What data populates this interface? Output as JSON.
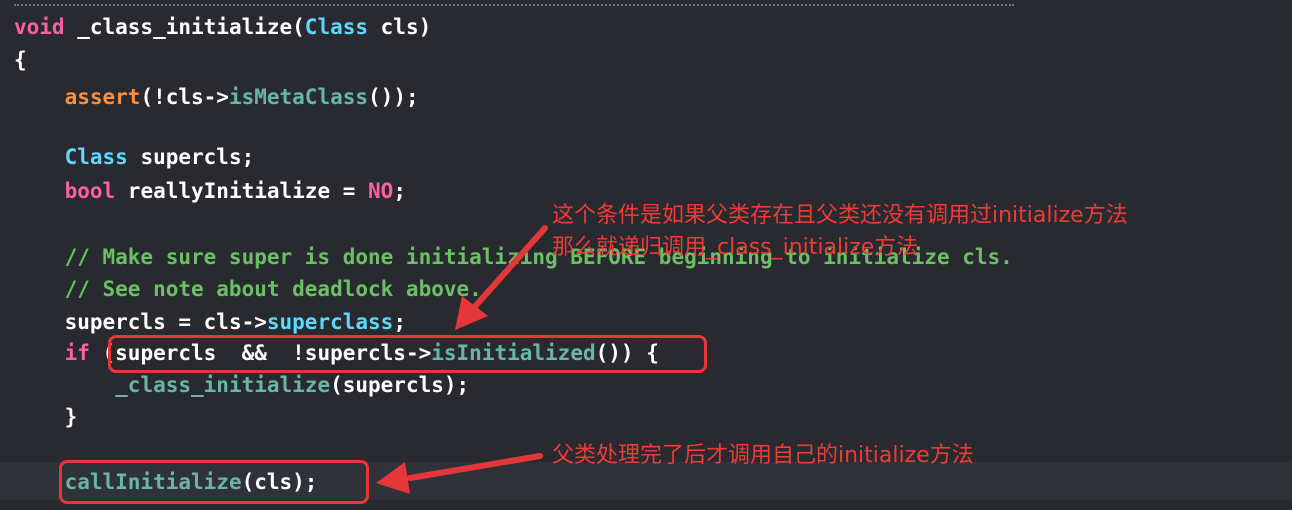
{
  "code": {
    "line1": {
      "kw": "void",
      "name": " _class_initialize(",
      "type": "Class",
      "rest": " cls)"
    },
    "line2": "{",
    "line3": {
      "indent": "    ",
      "macro": "assert",
      "p1": "(!cls->",
      "call": "isMetaClass",
      "p2": "());"
    },
    "line4": {
      "indent": "    ",
      "type": "Class",
      "rest": " supercls;"
    },
    "line5": {
      "indent": "    ",
      "kw": "bool",
      "mid": " reallyInitialize = ",
      "val": "NO",
      "end": ";"
    },
    "line6": "    // Make sure super is done initializing BEFORE beginning to initialize cls.",
    "line7": "    // See note about deadlock above.",
    "line8": {
      "indent": "    ",
      "p1": "supercls = cls->",
      "prop": "superclass",
      "end": ";"
    },
    "line9": {
      "indent": "    ",
      "kw": "if",
      "p1": " (supercls  &&  !supercls->",
      "call": "isInitialized",
      "end": "()) {"
    },
    "line10": {
      "indent": "        ",
      "call": "_class_initialize",
      "end": "(supercls);"
    },
    "line11": "    }",
    "line12": {
      "indent": "    ",
      "call": "callInitialize",
      "end": "(cls);"
    }
  },
  "annotations": {
    "note1_line1": "这个条件是如果父类存在且父类还没有调用过initialize方法",
    "note1_line2": "那么就递归调用_class_initialize方法",
    "note2": "父类处理完了后才调用自己的initialize方法"
  },
  "colors": {
    "background": "#292a30",
    "keyword": "#fc5fa3",
    "type": "#5dd8ff",
    "function": "#67b7a4",
    "comment": "#6bc064",
    "annotation": "#ef3b36"
  }
}
